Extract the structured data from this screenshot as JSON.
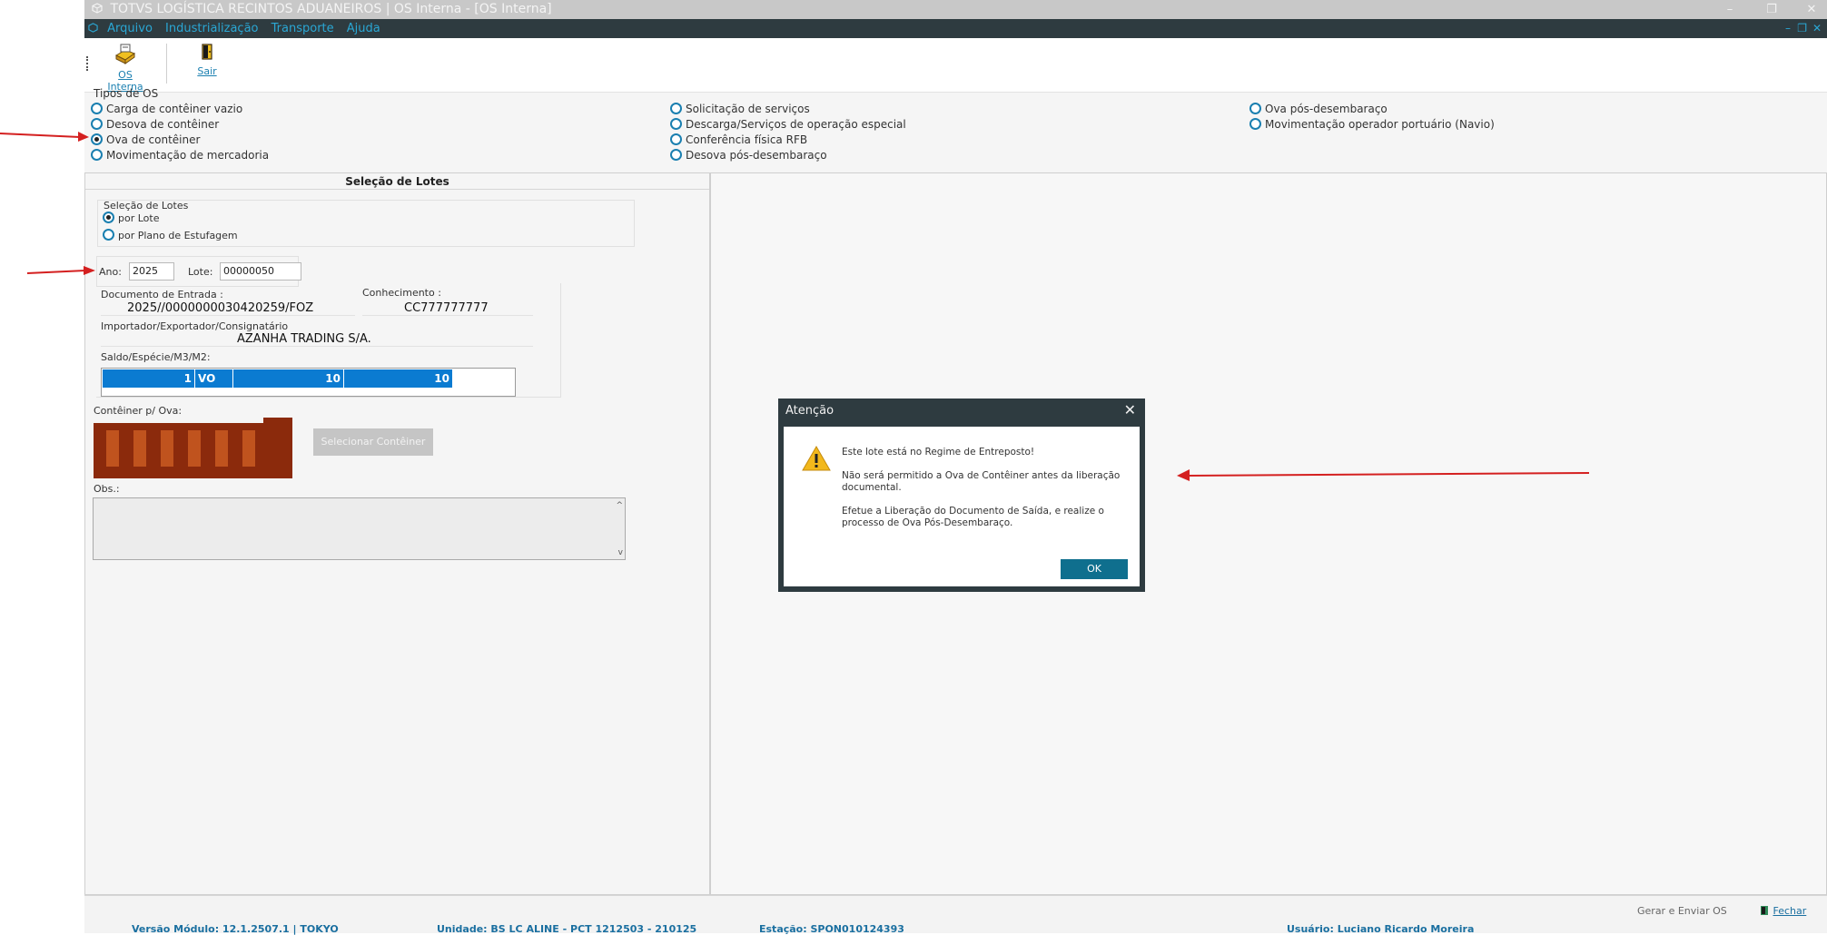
{
  "window": {
    "title": "TOTVS LOGÍSTICA RECINTOS ADUANEIROS | OS Interna - [OS Interna]"
  },
  "menu": {
    "items": [
      "Arquivo",
      "Industrialização",
      "Transporte",
      "Ajuda"
    ]
  },
  "toolbar": {
    "os_interna_label": "OS Interna",
    "sair_label": "Sair"
  },
  "tipos_os": {
    "label": "Tipos de OS",
    "options": [
      {
        "label": "Carga de contêiner vazio",
        "selected": false
      },
      {
        "label": "Desova de contêiner",
        "selected": false
      },
      {
        "label": "Ova de contêiner",
        "selected": true
      },
      {
        "label": "Movimentação de mercadoria",
        "selected": false
      },
      {
        "label": "Solicitação de serviços",
        "selected": false
      },
      {
        "label": "Descarga/Serviços de operação especial",
        "selected": false
      },
      {
        "label": "Conferência física RFB",
        "selected": false
      },
      {
        "label": "Desova pós-desembaraço",
        "selected": false
      },
      {
        "label": "Ova pós-desembaraço",
        "selected": false
      },
      {
        "label": "Movimentação operador portuário (Navio)",
        "selected": false
      }
    ]
  },
  "selecao": {
    "panel_title": "Seleção de Lotes",
    "group_label": "Seleção de Lotes",
    "opt_lote": "por Lote",
    "opt_plano": "por Plano de Estufagem",
    "ano_label": "Ano:",
    "ano_value": "2025",
    "lote_label": "Lote:",
    "lote_value": "00000050",
    "doc_entrada_label": "Documento de Entrada :",
    "doc_entrada_value": "2025//0000000030420259/FOZ",
    "conhecimento_label": "Conhecimento :",
    "conhecimento_value": "CC777777777",
    "importador_label": "Importador/Exportador/Consignatário",
    "importador_value": "AZANHA TRADING S/A.",
    "saldo_label": "Saldo/Espécie/M3/M2:",
    "saldo_values": [
      "1",
      "VO",
      "10",
      "10"
    ],
    "container_label": "Contêiner p/ Ova:",
    "selecionar_label": "Selecionar Contêiner",
    "obs_label": "Obs.:"
  },
  "status": {
    "gerar_label": "Gerar e Enviar OS",
    "fechar_label": "Fechar",
    "versao": "Versão Módulo:  12.1.2507.1  |  TOKYO",
    "unidade": "Unidade: BS LC ALINE - PCT 1212503 - 210125",
    "estacao": "Estação: SPON010124393",
    "usuario": "Usuário: Luciano Ricardo Moreira"
  },
  "dialog": {
    "title": "Atenção",
    "line1": "Este lote está no Regime de Entreposto!",
    "line2": "Não será permitido a Ova de Contêiner antes da liberação documental.",
    "line3": "Efetue a Liberação do Documento de Saída, e realize o processo de Ova Pós-Desembaraço.",
    "ok_label": "OK"
  },
  "colors": {
    "accent": "#1a7fb0",
    "menubar": "#2e3b40",
    "selection": "#0b7bd1",
    "container": "#8b2a0c",
    "annotation_arrow": "#d42020"
  }
}
